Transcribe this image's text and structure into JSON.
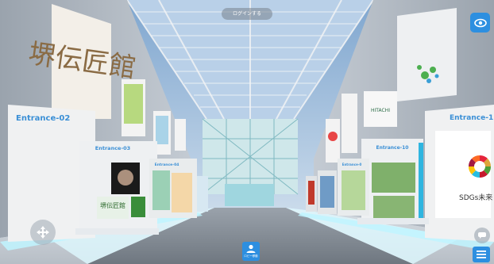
{
  "ui": {
    "login_label": "ログインする",
    "center_button_label": "ロビー移動",
    "icons": {
      "visibility": "eye-icon",
      "move": "move-arrows-icon",
      "chat": "chat-bubble-icon",
      "menu": "hamburger-menu-icon",
      "center": "user-avatar-icon"
    }
  },
  "booths": {
    "entrance_02": "Entrance-02",
    "entrance_03": "Entrance-03",
    "entrance_04": "Entrance-04",
    "entrance_10": "Entrance-10",
    "entrance_01": "Entrance-1",
    "entrance_right_partial": "Entrance-0"
  },
  "signage": {
    "left_kanji_banner": "堺伝匠館",
    "left_booth_poster_text": "堺伝匠館",
    "sdgs_right": "SDGs未来",
    "hitachi_sign": "HITACHI"
  },
  "colors": {
    "accent_blue": "#2d8fe0",
    "booth_label_blue": "#3a8fd6",
    "floor": "#c7ccd2",
    "glow_cyan": "#bff5ff"
  }
}
